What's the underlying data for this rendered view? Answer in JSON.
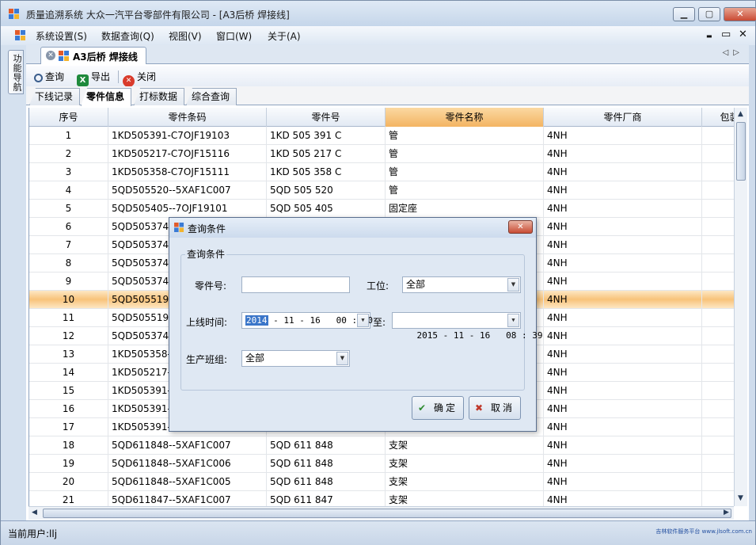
{
  "window": {
    "title": "质量追溯系统   大众一汽平台零部件有限公司 - [A3后桥  焊接线]",
    "controls": [
      "▁",
      "▢",
      "✕"
    ]
  },
  "menu": {
    "items": [
      "系统设置(S)",
      "数据查询(Q)",
      "视图(V)",
      "窗口(W)",
      "关于(A)"
    ],
    "mdi_controls": [
      "▬",
      "▭",
      "✕"
    ]
  },
  "sidebar": {
    "tab_label": "功能导航"
  },
  "doc_tab": {
    "label": "A3后桥  焊接线",
    "nav": "◁▷"
  },
  "toolbar": {
    "query_label": "查询",
    "export_label": "导出",
    "close_label": "关闭"
  },
  "subtabs": [
    "下线记录",
    "零件信息",
    "打标数据",
    "综合查询"
  ],
  "grid": {
    "columns": [
      "序号",
      "零件条码",
      "零件号",
      "零件名称",
      "零件厂商",
      "包装"
    ],
    "rows": [
      [
        "1",
        "1KD505391-C7OJF19103",
        "1KD 505 391 C",
        "管",
        "4NH"
      ],
      [
        "2",
        "1KD505217-C7OJF15116",
        "1KD 505 217 C",
        "管",
        "4NH"
      ],
      [
        "3",
        "1KD505358-C7OJF15111",
        "1KD 505 358 C",
        "管",
        "4NH"
      ],
      [
        "4",
        "5QD505520--5XAF1C007",
        "5QD 505 520",
        "管",
        "4NH"
      ],
      [
        "5",
        "5QD505405--7OJF19101",
        "5QD 505 405",
        "固定座",
        "4NH"
      ],
      [
        "6",
        "5QD505374-",
        "",
        "",
        "4NH"
      ],
      [
        "7",
        "5QD505374-",
        "",
        "",
        "4NH"
      ],
      [
        "8",
        "5QD505374-",
        "",
        "",
        "4NH"
      ],
      [
        "9",
        "5QD505374-",
        "",
        "",
        "4NH"
      ],
      [
        "10",
        "5QD505519-",
        "",
        "",
        "4NH"
      ],
      [
        "11",
        "5QD505519-",
        "",
        "",
        "4NH"
      ],
      [
        "12",
        "5QD505374-",
        "",
        "",
        "4NH"
      ],
      [
        "13",
        "1KD505358-C",
        "",
        "",
        "4NH"
      ],
      [
        "14",
        "1KD505217-C",
        "",
        "",
        "4NH"
      ],
      [
        "15",
        "1KD505391-C",
        "",
        "",
        "4NH"
      ],
      [
        "16",
        "1KD505391-C",
        "",
        "",
        "4NH"
      ],
      [
        "17",
        "1KD505391-C",
        "",
        "",
        "4NH"
      ],
      [
        "18",
        "5QD611848--5XAF1C007",
        "5QD 611 848",
        "支架",
        "4NH"
      ],
      [
        "19",
        "5QD611848--5XAF1C006",
        "5QD 611 848",
        "支架",
        "4NH"
      ],
      [
        "20",
        "5QD611848--5XAF1C005",
        "5QD 611 848",
        "支架",
        "4NH"
      ],
      [
        "21",
        "5QD611847--5XAF1C007",
        "5QD 611 847",
        "支架",
        "4NH"
      ]
    ]
  },
  "status": {
    "user": "当前用户:llj",
    "watermark": "吉林软件服务平台  www.jlsoft.com.cn"
  },
  "dialog": {
    "title": "查询条件",
    "group_label": "查询条件",
    "part_no_label": "零件号:",
    "part_no_value": "",
    "station_label": "工位:",
    "station_value": "全部",
    "online_time_label": "上线时间:",
    "start_year": "2014",
    "start_rest": " - 11 - 16   00 : 00",
    "to_label": "至:",
    "end_value": "2015 - 11 - 16   08 : 39",
    "team_label": "生产班组:",
    "team_value": "全部",
    "ok_label": "确定",
    "cancel_label": "取消"
  }
}
